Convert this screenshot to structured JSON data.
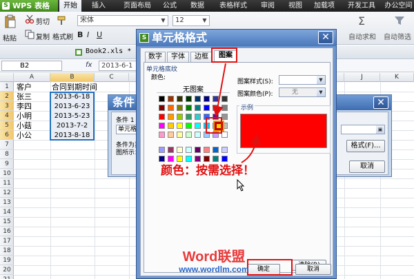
{
  "app": {
    "name": "WPS 表格",
    "tabs": [
      "开始",
      "插入",
      "页面布局",
      "公式",
      "数据",
      "表格样式",
      "审阅",
      "视图",
      "加载项",
      "开发工具",
      "办公空间"
    ],
    "active_tab": "开始"
  },
  "ribbon": {
    "paste": "粘贴",
    "cut": "剪切",
    "copy": "复制",
    "format_painter": "格式刷",
    "font_name": "宋体",
    "font_size": "12",
    "autosum": "自动求和",
    "autofilter": "自动筛选"
  },
  "file_tab": "Book2.xls *",
  "formula_bar": {
    "name_box": "B2",
    "fx": "fx",
    "value": "2013-6-1"
  },
  "sheet": {
    "columns": [
      "A",
      "B",
      "C",
      "D",
      "E",
      "F",
      "G",
      "H",
      "I",
      "J",
      "K"
    ],
    "rows": [
      "1",
      "2",
      "3",
      "4",
      "5",
      "6",
      "7",
      "8",
      "9",
      "10",
      "11",
      "12",
      "13",
      "14",
      "15",
      "16",
      "17",
      "18",
      "19",
      "20",
      "21"
    ],
    "header_a": "客户",
    "header_b": "合同到期时间",
    "data": [
      {
        "name": "张三",
        "date": "2013-6-18"
      },
      {
        "name": "李四",
        "date": "2013-6-23"
      },
      {
        "name": "小明",
        "date": "2013-5-23"
      },
      {
        "name": "小菇",
        "date": "2013-7-2"
      },
      {
        "name": "小公",
        "date": "2013-8-18"
      }
    ]
  },
  "cond_dialog": {
    "title": "条件",
    "condition_label": "条件 1",
    "dropdown_value": "单元格",
    "desc_line1": "条件为真",
    "desc_line2": "图所示：",
    "format_button": "格式(F)...",
    "cancel_button": "取消",
    "close_glyph": "✕"
  },
  "format_dialog": {
    "title": "单元格格式",
    "close_glyph": "✕",
    "tabs": [
      "数字",
      "字体",
      "边框",
      "图案"
    ],
    "active_tab": "图案",
    "shading_group": "单元格底纹",
    "color_label": "颜色:",
    "no_color": "无图案",
    "pattern_style_label": "图案样式(S):",
    "pattern_color_label": "图案颜色(P):",
    "pattern_color_value": "无",
    "sample_label": "示例",
    "clear_button": "清除(R)",
    "ok_button": "确定",
    "cancel_button": "取消",
    "selected_color": "#ff0000"
  },
  "annotation": {
    "text": "颜色：按需选择！",
    "watermark_line1": "Word联盟",
    "watermark_line2": "www.wordlm.com"
  },
  "palette_rows": [
    [
      "#000000",
      "#993300",
      "#333300",
      "#003300",
      "#003366",
      "#000080",
      "#333399",
      "#333333"
    ],
    [
      "#800000",
      "#ff6600",
      "#808000",
      "#008000",
      "#008080",
      "#0000ff",
      "#666699",
      "#808080"
    ],
    [
      "#ff0000",
      "#ff9900",
      "#99cc00",
      "#339966",
      "#33cccc",
      "#3366ff",
      "#800080",
      "#969696"
    ],
    [
      "#ff00ff",
      "#ffcc00",
      "#ffff00",
      "#00ff00",
      "#00ffff",
      "#00ccff",
      "#993366",
      "#c0c0c0"
    ],
    [
      "#ff99cc",
      "#ffcc99",
      "#ffff99",
      "#ccffcc",
      "#ccffff",
      "#99ccff",
      "#cc99ff",
      "#ffffff"
    ]
  ],
  "palette_extra": [
    [
      "#9999ff",
      "#993366",
      "#ffffcc",
      "#ccffff",
      "#660066",
      "#ff8080",
      "#0066cc",
      "#ccccff"
    ],
    [
      "#000080",
      "#ff00ff",
      "#ffff00",
      "#00ffff",
      "#800080",
      "#800000",
      "#008080",
      "#0000ff"
    ]
  ]
}
